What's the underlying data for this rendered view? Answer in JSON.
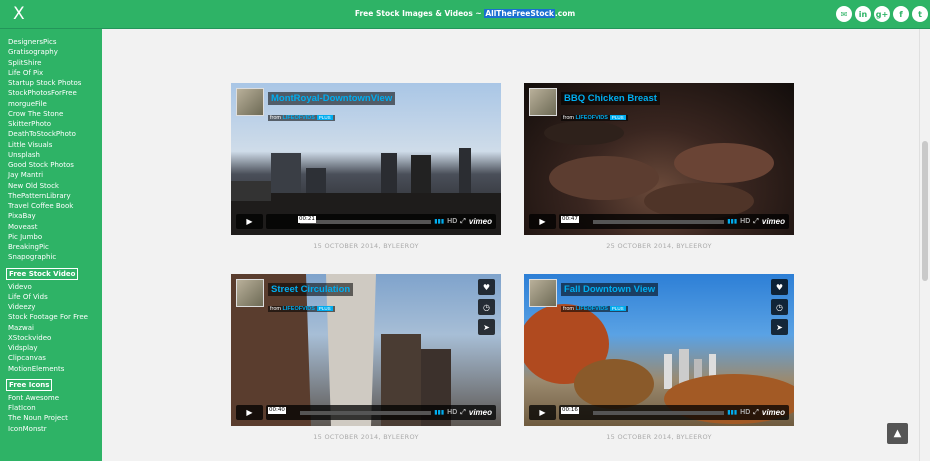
{
  "header": {
    "close_label": "X",
    "title_prefix": "Free Stock Images & Videos ~",
    "site_name": "AllTheFreeStock",
    "site_suffix": ".com",
    "social": [
      "✉",
      "in",
      "g+",
      "f",
      "t"
    ]
  },
  "sidebar": {
    "images": [
      "DesignersPics",
      "Gratisography",
      "SplitShire",
      "Life Of Pix",
      "Startup Stock Photos",
      "StockPhotosForFree",
      "morgueFile",
      "Crow The Stone",
      "SkitterPhoto",
      "DeathToStockPhoto",
      "Little Visuals",
      "Unsplash",
      "Good Stock Photos",
      "Jay Mantri",
      "New Old Stock",
      "ThePatternLibrary",
      "Travel Coffee Book",
      "PixaBay",
      "Moveast",
      "Pic Jumbo",
      "BreakingPic",
      "Snapographic"
    ],
    "video_heading": "Free Stock Video",
    "videos": [
      "Videvo",
      "Life Of Vids",
      "Videezy",
      "Stock Footage For Free",
      "Mazwai",
      "XStockvideo",
      "Vidsplay",
      "Clipcanvas",
      "MotionElements"
    ],
    "icons_heading": "Free Icons",
    "icons": [
      "Font Awesome",
      "FlatIcon",
      "The Noun Project",
      "IconMonstr"
    ]
  },
  "videos": [
    {
      "title": "MontRoyal-DowntownView",
      "from": "from",
      "author": "LIFEOFVIDS",
      "badge": "PLUS",
      "time": "00:21",
      "hd": "HD",
      "vimeo": "vimeo",
      "caption": "15 OCTOBER 2014, BYLEEROY"
    },
    {
      "title": "BBQ Chicken Breast",
      "from": "from",
      "author": "LIFEOFVIDS",
      "badge": "PLUS",
      "time": "00:47",
      "hd": "HD",
      "vimeo": "vimeo",
      "caption": "25 OCTOBER 2014, BYLEEROY"
    },
    {
      "title": "Street Circulation",
      "from": "from",
      "author": "LIFEOFVIDS",
      "badge": "PLUS",
      "time": "00:40",
      "hd": "HD",
      "vimeo": "vimeo",
      "caption": "15 OCTOBER 2014, BYLEEROY"
    },
    {
      "title": "Fall Downtown View",
      "from": "from",
      "author": "LIFEOFVIDS",
      "badge": "PLUS",
      "time": "00:16",
      "hd": "HD",
      "vimeo": "vimeo",
      "caption": "15 OCTOBER 2014, BYLEEROY"
    }
  ],
  "colors": {
    "accent": "#2eb366",
    "vimeo_blue": "#00adef"
  }
}
